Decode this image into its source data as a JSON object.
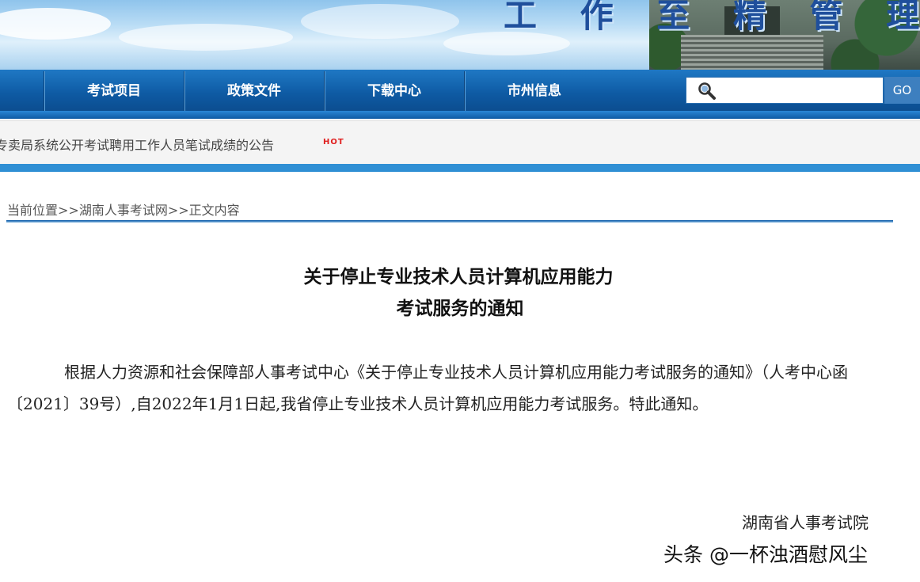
{
  "banner": {
    "slogan": "工 作 至 精  管 理 至 严",
    "colors": {
      "slogan": "#1f4f9c",
      "sky": "#b9dcf5"
    }
  },
  "nav": {
    "items": [
      {
        "label": "考试项目"
      },
      {
        "label": "政策文件"
      },
      {
        "label": "下载中心"
      },
      {
        "label": "市州信息"
      }
    ],
    "search": {
      "value": "",
      "placeholder": "",
      "button_label": "GO",
      "icon": "search-icon"
    },
    "colors": {
      "bar": "#0e5aa3"
    }
  },
  "ticker": {
    "text": "专卖局系统公开考试聘用工作人员笔试成绩的公告",
    "badge": "HOT",
    "badge_color": "#e02020"
  },
  "breadcrumb": {
    "text": "当前位置>>湖南人事考试网>>正文内容"
  },
  "article": {
    "title_line1": "关于停止专业技术人员计算机应用能力",
    "title_line2": "考试服务的通知",
    "body": "根据人力资源和社会保障部人事考试中心《关于停止专业技术人员计算机应用能力考试服务的通知》（人考中心函〔2021〕39号）,自2022年1月1日起,我省停止专业技术人员计算机应用能力考试服务。特此通知。",
    "signature": "湖南省人事考试院"
  },
  "watermark": {
    "text": "头条 @一杯浊酒慰风尘"
  }
}
